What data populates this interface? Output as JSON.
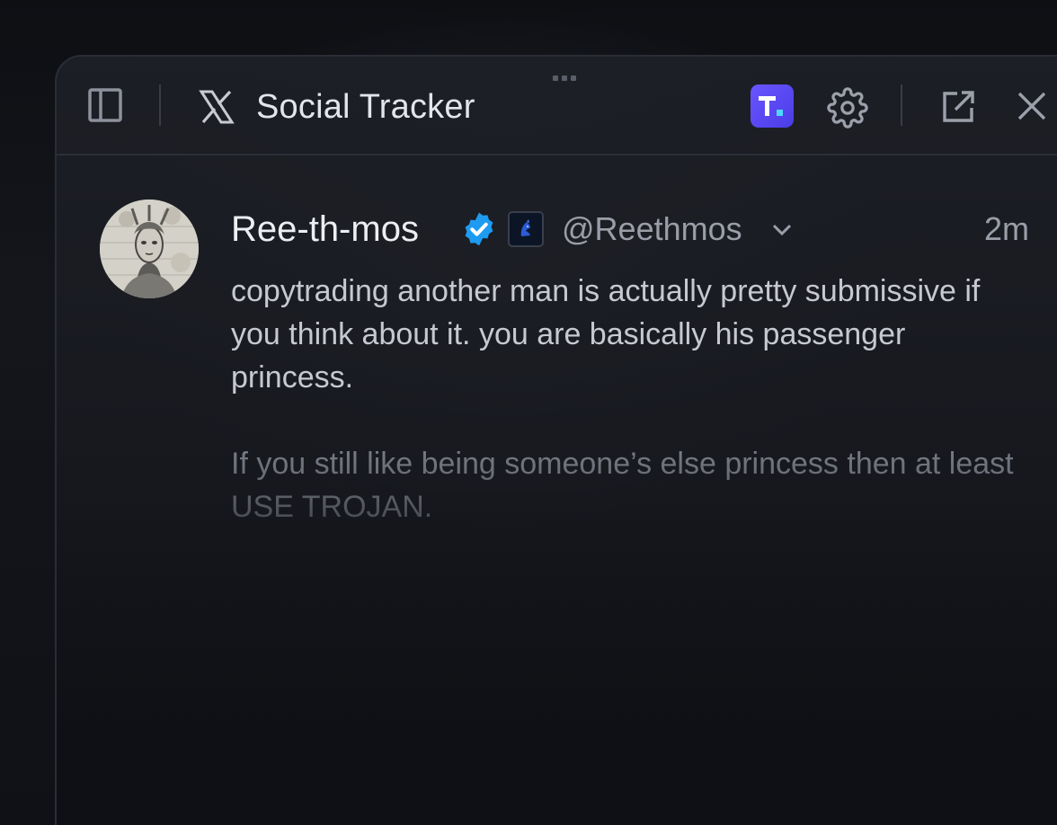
{
  "window": {
    "title": "Social Tracker",
    "accent_badge_color": "#5b4af0"
  },
  "header": {
    "icons": [
      "sidebar-toggle-icon",
      "x-logo-icon",
      "t-app-badge-icon",
      "gear-icon",
      "external-link-icon",
      "close-icon"
    ]
  },
  "tweet": {
    "display_name": "Ree-th-mos",
    "verified": true,
    "handle": "@Reethmos",
    "time": "2m",
    "paragraph_1": "copytrading another man is actually pretty submissive if you think about it. you are basically his passenger princess.",
    "paragraph_2": "If you still like being someone’s else princess then at least USE TROJAN."
  }
}
